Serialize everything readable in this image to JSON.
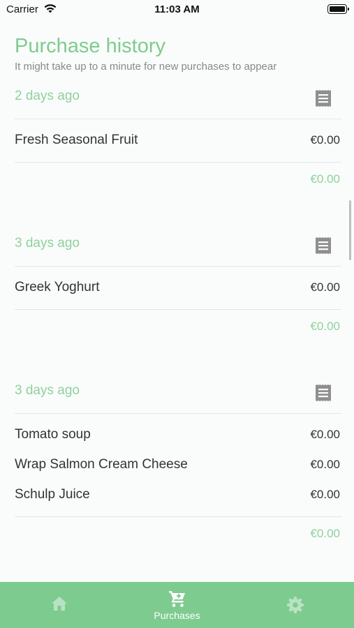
{
  "status_bar": {
    "carrier": "Carrier",
    "time": "11:03 AM"
  },
  "header": {
    "title": "Purchase history",
    "subtitle": "It might take up to a minute for new purchases to appear"
  },
  "colors": {
    "accent": "#7ecb8f",
    "tab_bar": "#7ecb8f",
    "muted_text": "#888888",
    "divider": "#e4e6e5"
  },
  "purchases": [
    {
      "date": "2 days ago",
      "icon": "receipt-icon",
      "items": [
        {
          "name": "Fresh Seasonal Fruit",
          "price": "€0.00"
        }
      ],
      "total": "€0.00"
    },
    {
      "date": "3 days ago",
      "icon": "receipt-icon",
      "items": [
        {
          "name": "Greek Yoghurt",
          "price": "€0.00"
        }
      ],
      "total": "€0.00"
    },
    {
      "date": "3 days ago",
      "icon": "receipt-icon",
      "items": [
        {
          "name": "Tomato soup",
          "price": "€0.00"
        },
        {
          "name": "Wrap Salmon Cream Cheese",
          "price": "€0.00"
        },
        {
          "name": "Schulp Juice",
          "price": "€0.00"
        }
      ],
      "total": "€0.00"
    }
  ],
  "tab_bar": {
    "tabs": [
      {
        "icon": "home-icon",
        "label": ""
      },
      {
        "icon": "cart-icon",
        "label": "Purchases",
        "selected": true
      },
      {
        "icon": "gear-icon",
        "label": ""
      }
    ]
  }
}
